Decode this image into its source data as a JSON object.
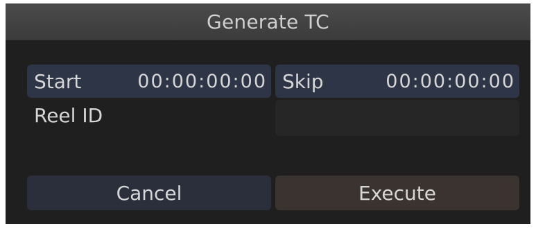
{
  "dialog": {
    "title": "Generate TC",
    "start": {
      "label": "Start",
      "value": "00:00:00:00"
    },
    "skip": {
      "label": "Skip",
      "value": "00:00:00:00"
    },
    "reel_id": {
      "label": "Reel ID",
      "value": ""
    },
    "buttons": {
      "cancel": "Cancel",
      "execute": "Execute"
    }
  }
}
